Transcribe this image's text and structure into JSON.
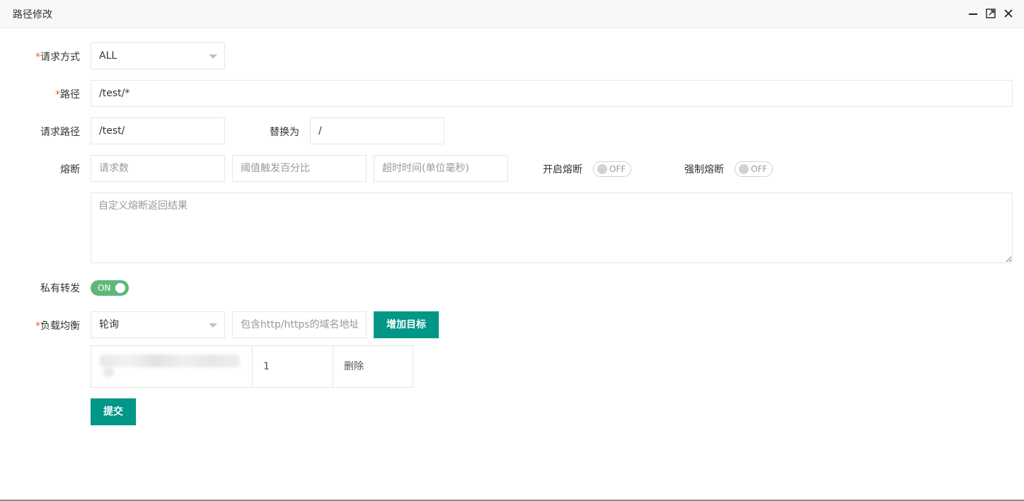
{
  "window": {
    "title": "路径修改"
  },
  "form": {
    "method": {
      "label": "请求方式",
      "value": "ALL"
    },
    "path": {
      "label": "路径",
      "value": "/test/*"
    },
    "request_path": {
      "label": "请求路径",
      "value": "/test/",
      "replace_label": "替换为",
      "replace_value": "/"
    },
    "circuit_breaker": {
      "label": "熔断",
      "request_count_placeholder": "请求数",
      "threshold_placeholder": "阈值触发百分比",
      "timeout_placeholder": "超时时间(单位毫秒)",
      "enable_label": "开启熔断",
      "enable_state": "OFF",
      "force_label": "强制熔断",
      "force_state": "OFF",
      "custom_result_placeholder": "自定义熔断返回结果"
    },
    "private_forward": {
      "label": "私有转发",
      "state": "ON"
    },
    "load_balance": {
      "label": "负载均衡",
      "strategy": "轮询",
      "domain_placeholder": "包含http/https的域名地址",
      "add_target_label": "增加目标",
      "targets": [
        {
          "address": "",
          "weight": "1",
          "action": "删除"
        }
      ]
    },
    "submit_label": "提交"
  },
  "colors": {
    "primary": "#009688",
    "switch_on": "#5fb878",
    "required_mark": "#ff5722"
  }
}
